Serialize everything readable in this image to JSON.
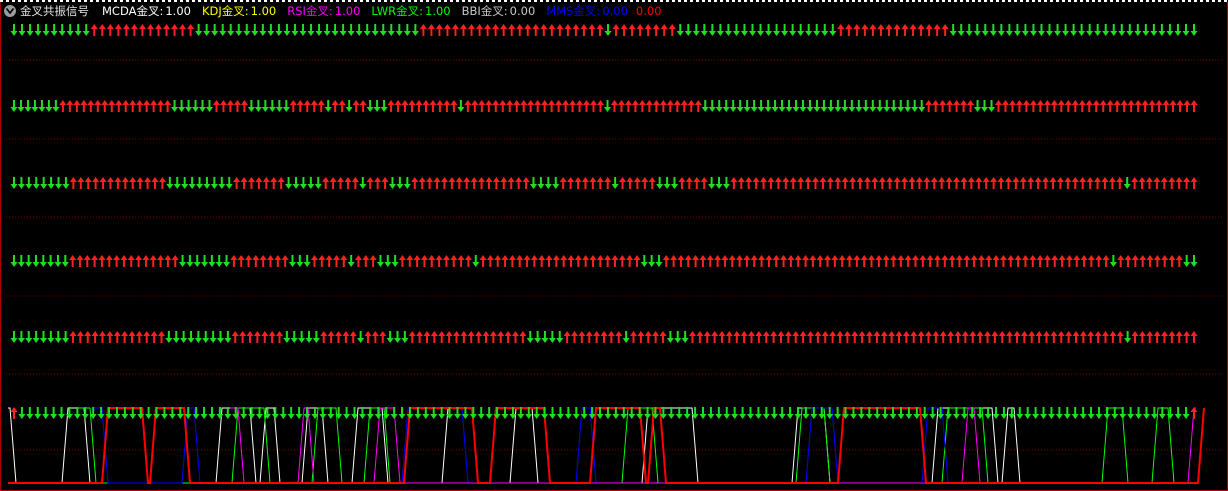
{
  "indicator": {
    "title": "金叉共振信号",
    "menu_icon": "chevron-down-icon",
    "items": [
      {
        "label": "MCDA金叉:",
        "value": "1.00",
        "color": "#ffffff"
      },
      {
        "label": "KDJ金叉:",
        "value": "1.00",
        "color": "#ffff00"
      },
      {
        "label": "RSI金叉:",
        "value": "1.00",
        "color": "#ff00ff"
      },
      {
        "label": "LWR金叉:",
        "value": "1.00",
        "color": "#00ff00"
      },
      {
        "label": "BBI金叉:",
        "value": "0.00",
        "color": "#c8c8c8"
      },
      {
        "label": "MMS金叉:",
        "value": "0.00",
        "color": "#0000ff",
        "extra_value": "0.00",
        "extra_color": "#ff0000"
      }
    ]
  },
  "colors": {
    "up": "#ff2020",
    "down": "#22dd22",
    "grid": "#7a0000",
    "border": "#b00000"
  },
  "signal_rows": [
    "DDDDDDDDDDUUUUUUUUUUUUUDDDDDDDDDDDDDDDDDDDDDDDDDDDDUUUUUUUUUUUUUUUUUUUUUUUDUUUUUUUUDDDDDDDDDDDDDDDDDDDDUUUUUUUUUUUUUUDDDDDDDDDDDDDDDDDDDDDDDDDDDDDDD",
    "DDDDDDDUUUUUUUUUUUUUUUUDDDDDDUUUUUDDDDDDUUUUUDUUDUUDDDUUUUUUUUUUDUUUUUUUUUUUUUUUUUUUUDUUUUUUUUUUUUUDDDDDDDDDDDDDDDDDDDDDDDDDDDDDDDDUUUUUUUDDDUUUUUUUUUUUUUUUUUUUUUUUUUUUUU",
    "DDDDDDDDUUUUUUUUUUUUUDDDDDDDDDUUUUUUUDDDDDUUUUUDUUUDDDUUUUUUUUUUUUUUUUDDDDUUUUUUUDUUUUUDDDUUUUDDDUUUUUUUUUUUUUUUUUUUUUUUUUUUUUUUUUUUUUUUUUUUUUUUUUUUUUDUUUUUUUUU",
    "DDDDDDDDUUUUUUUUUUUUUUUDDDDDDDUUUUUUUUDDDUUUUUDUUUDDDUUUUUUUUUUDUUUUUUUUUUUUUUUUUUUUUUDDDUUUUUUUUUUUUUUUUUUUUUUUUUUUUUUUUUUUUUUUUUUUUUUUUUUUUUUUUUUUUUDUUUUUUUUUDD",
    "DDDDDDDDUUUUUUUUUUUUUDDDDDDDDDUUUUUUUDDDDDUUUUUDUUUDDDUUUUUUUUUUUUUUUUDDDDDUUUUUUUUDUUUUUDDDUUUUUUUUUUUUUUUUUUUUUUUUUUUUUUUUUUUUUUUUUUUUUUUUUUUUUUUUUUUDUUUUUUUUU",
    "UDDDDDDDDDDDDDDDDDDDDDDDDDDDDDDDDDDDDDDDDDDDDDDDDDDDDDDDDDDDDDDDDDDDDDDDDDDDDDDDDDDDDDDDDDDDDDDDDDDDDDDDDDDDDDDDDDDDDDDDDDDDDDDDDDDDDDDDDDDDDDDDDDDDDU"
  ],
  "chart_data": {
    "type": "line",
    "ylim": [
      0,
      1
    ],
    "series": [
      {
        "color": "#ffffff",
        "steps": [
          [
            0,
            1
          ],
          [
            8,
            0
          ],
          [
            60,
            1
          ],
          [
            82,
            0
          ],
          [
            214,
            1
          ],
          [
            248,
            0
          ],
          [
            258,
            1
          ],
          [
            272,
            0
          ],
          [
            300,
            1
          ],
          [
            320,
            0
          ],
          [
            350,
            1
          ],
          [
            380,
            0
          ],
          [
            440,
            1
          ],
          [
            470,
            0
          ],
          [
            508,
            1
          ],
          [
            530,
            0
          ],
          [
            640,
            1
          ],
          [
            690,
            0
          ],
          [
            790,
            1
          ],
          [
            822,
            0
          ],
          [
            930,
            1
          ],
          [
            990,
            0
          ],
          [
            1000,
            1
          ],
          [
            1012,
            0
          ]
        ]
      },
      {
        "color": "#00ff00",
        "steps": [
          [
            70,
            1
          ],
          [
            88,
            0
          ],
          [
            230,
            1
          ],
          [
            262,
            0
          ],
          [
            310,
            1
          ],
          [
            334,
            0
          ],
          [
            362,
            1
          ],
          [
            382,
            0
          ],
          [
            620,
            1
          ],
          [
            650,
            0
          ],
          [
            794,
            1
          ],
          [
            822,
            0
          ],
          [
            940,
            1
          ],
          [
            980,
            0
          ],
          [
            1100,
            1
          ],
          [
            1120,
            0
          ],
          [
            1150,
            1
          ],
          [
            1166,
            0
          ]
        ]
      },
      {
        "color": "#0000ff",
        "steps": [
          [
            84,
            1
          ],
          [
            100,
            0
          ],
          [
            180,
            1
          ],
          [
            192,
            0
          ],
          [
            400,
            1
          ],
          [
            460,
            0
          ],
          [
            574,
            1
          ],
          [
            588,
            0
          ],
          [
            804,
            1
          ],
          [
            830,
            0
          ],
          [
            920,
            1
          ],
          [
            940,
            0
          ]
        ]
      },
      {
        "color": "#ff00ff",
        "steps": [
          [
            222,
            1
          ],
          [
            236,
            0
          ],
          [
            296,
            1
          ],
          [
            306,
            0
          ],
          [
            372,
            1
          ],
          [
            392,
            0
          ],
          [
            960,
            1
          ],
          [
            972,
            0
          ],
          [
            1186,
            1
          ]
        ]
      },
      {
        "color": "#ff0000",
        "steps": [
          [
            0,
            0
          ],
          [
            90,
            0
          ],
          [
            100,
            1
          ],
          [
            130,
            1
          ],
          [
            140,
            0
          ],
          [
            148,
            1
          ],
          [
            172,
            1
          ],
          [
            182,
            0
          ],
          [
            392,
            0
          ],
          [
            402,
            1
          ],
          [
            460,
            1
          ],
          [
            470,
            0
          ],
          [
            488,
            1
          ],
          [
            532,
            1
          ],
          [
            542,
            0
          ],
          [
            580,
            0
          ],
          [
            588,
            1
          ],
          [
            630,
            1
          ],
          [
            638,
            0
          ],
          [
            646,
            1
          ],
          [
            650,
            1
          ],
          [
            658,
            0
          ],
          [
            826,
            0
          ],
          [
            836,
            1
          ],
          [
            908,
            1
          ],
          [
            918,
            0
          ],
          [
            1190,
            0
          ],
          [
            1196,
            1
          ]
        ]
      }
    ]
  }
}
